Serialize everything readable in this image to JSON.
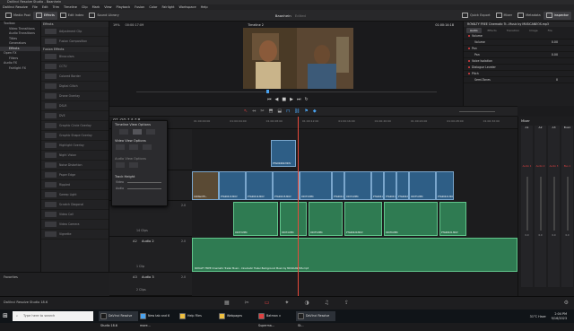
{
  "app": {
    "title": "DaVinci Resolve Studio - Baanhein",
    "project_name": "Baanhein",
    "project_status": "Edited",
    "version_label": "DaVinci Resolve Studio 18.6"
  },
  "menu": [
    "DaVinci Resolve",
    "File",
    "Edit",
    "Trim",
    "Timeline",
    "Clip",
    "Mark",
    "View",
    "Playback",
    "Fusion",
    "Color",
    "Fairlight",
    "Workspace",
    "Help"
  ],
  "toolbar": {
    "media_pool": "Media Pool",
    "effects": "Effects",
    "edit_index": "Edit Index",
    "sound_library": "Sound Library",
    "quick_export": "Quick Export",
    "mixer": "Mixer",
    "metadata": "Metadata",
    "inspector": "Inspector"
  },
  "left_panel": {
    "items": [
      {
        "label": "Toolbox",
        "level": 0
      },
      {
        "label": "Video Transitions",
        "level": 1
      },
      {
        "label": "Audio Transitions",
        "level": 1
      },
      {
        "label": "Titles",
        "level": 1
      },
      {
        "label": "Generators",
        "level": 1
      },
      {
        "label": "Effects",
        "level": 1,
        "selected": true
      },
      {
        "label": "Open FX",
        "level": 0
      },
      {
        "label": "Filters",
        "level": 1
      },
      {
        "label": "Audio FX",
        "level": 0
      },
      {
        "label": "Fairlight FX",
        "level": 1
      }
    ],
    "favorites": "Favorites"
  },
  "effects_list": {
    "section_effects": "Effects",
    "effects_items": [
      "Adjustment Clip",
      "Fusion Composition"
    ],
    "section_fusion": "Fusion Effects",
    "fusion_items": [
      "Binoculars",
      "CCTV",
      "Colored Border",
      "Digital Glitch",
      "Drone Overlay",
      "DSLR",
      "DVE",
      "Graphic Circle Overlay",
      "Graphic Shape Overlay",
      "Highlight Overlay",
      "Night Vision",
      "Noise Distortion",
      "Paper Edge",
      "Rippled",
      "Sweep Light",
      "Scratch Diagonal",
      "Video Call",
      "Video Camera",
      "Vignette"
    ]
  },
  "viewer": {
    "zoom": "19%",
    "timecode_in": "00:00:17:09",
    "timeline_name": "Timeline 2",
    "timecode_out": "01:00:14:18"
  },
  "inspector": {
    "clip_title": "ROYALTY FREE Cinematic Tr...Music by MUSICANEOS.mp3",
    "tabs": [
      "Audio",
      "Effects",
      "Transition",
      "Image",
      "File"
    ],
    "rows": [
      {
        "label": "Volume",
        "value": ""
      },
      {
        "label": "Volume",
        "value": "0.00"
      },
      {
        "label": "Pan",
        "value": ""
      },
      {
        "label": "Pan",
        "value": "0.00"
      },
      {
        "label": "Voice Isolation",
        "value": ""
      },
      {
        "label": "Dialogue Leveler",
        "value": ""
      },
      {
        "label": "Pitch",
        "value": ""
      },
      {
        "label": "Semi-Tones",
        "value": "0"
      }
    ]
  },
  "timeline": {
    "timecode": "01:00:14:18",
    "ruler_marks": [
      "01:00:00:00",
      "01:00:04:00",
      "01:00:08:00",
      "01:00:12:00",
      "01:00:16:00",
      "01:00:20:00",
      "01:00:24:00",
      "01:00:28:00",
      "01:00:32:00"
    ],
    "tracks": [
      {
        "id": "V2",
        "name": "Video 2",
        "clips": "1 Clip"
      },
      {
        "id": "V1",
        "name": "Video 1",
        "clips": "14 Clips"
      },
      {
        "id": "A1",
        "name": "Audio 1",
        "level": "2.0",
        "clips": "14 Clips"
      },
      {
        "id": "A2",
        "name": "Audio 2",
        "level": "2.0",
        "clips": "1 Clip"
      },
      {
        "id": "A3",
        "name": "Audio 3",
        "level": "2.0",
        "clips": "2 Clips"
      }
    ],
    "v2_clip": "PTG00460.MOV",
    "v1_clips": [
      "Untitled Fil...",
      "PTG00413.MOV",
      "PTG00414.MOV",
      "PTG00415.MOV",
      "C0073.MP4",
      "PTG00416.MOV",
      "C0074.MP4",
      "PTG00417.MOV",
      "PTG00419.MOV",
      "PTG00420.MOV",
      "C0075.MP4",
      "PTG00421.MOV"
    ],
    "a1_clips": [
      "C0073.MP4",
      "C0074.MP4",
      "C0075.MP4",
      "PTG00420.MOV",
      "C0076.MP4",
      "PTG00421.MOV"
    ],
    "a2_clip": "ROYALTY FREE Cinematic Trailer Music - Cinematic Trailer Background Music by MUSICANEOS.mp3"
  },
  "popup": {
    "title": "Timeline View Options",
    "video_view_options": "Video View Options",
    "audio_view_options": "Audio View Options",
    "track_height": "Track Height",
    "video_label": "Video",
    "audio_label": "Audio"
  },
  "mixer": {
    "title": "Mixer",
    "channels": [
      "A1",
      "A2",
      "A3",
      "Bus1"
    ],
    "strip_labels": [
      "Audio 1",
      "Audio 2",
      "Audio 3",
      "Bus 1"
    ],
    "values": [
      "0.0",
      "0.0",
      "0.0",
      "0.0"
    ]
  },
  "taskbar": {
    "search_placeholder": "Type here to search",
    "apps": [
      {
        "label": "DaVinci Resolve Studio 18.6",
        "color": "#1a1a1a"
      },
      {
        "label": "New tab and 6 more...",
        "color": "#4aa3f0"
      },
      {
        "label": "Help Files",
        "color": "#f0c040"
      },
      {
        "label": "Webpages",
        "color": "#f0c040"
      },
      {
        "label": "Batman v Superma...",
        "color": "#e04040"
      },
      {
        "label": "DaVinci Resolve St...",
        "color": "#202020"
      }
    ],
    "weather": "31°C Haze",
    "time": "2:04 PM",
    "date": "9/16/2023"
  },
  "colors": {
    "video_clip": "#2e5e86",
    "audio_clip": "#2f7b52",
    "playhead": "#e84a3c",
    "accent": "#e04040"
  }
}
